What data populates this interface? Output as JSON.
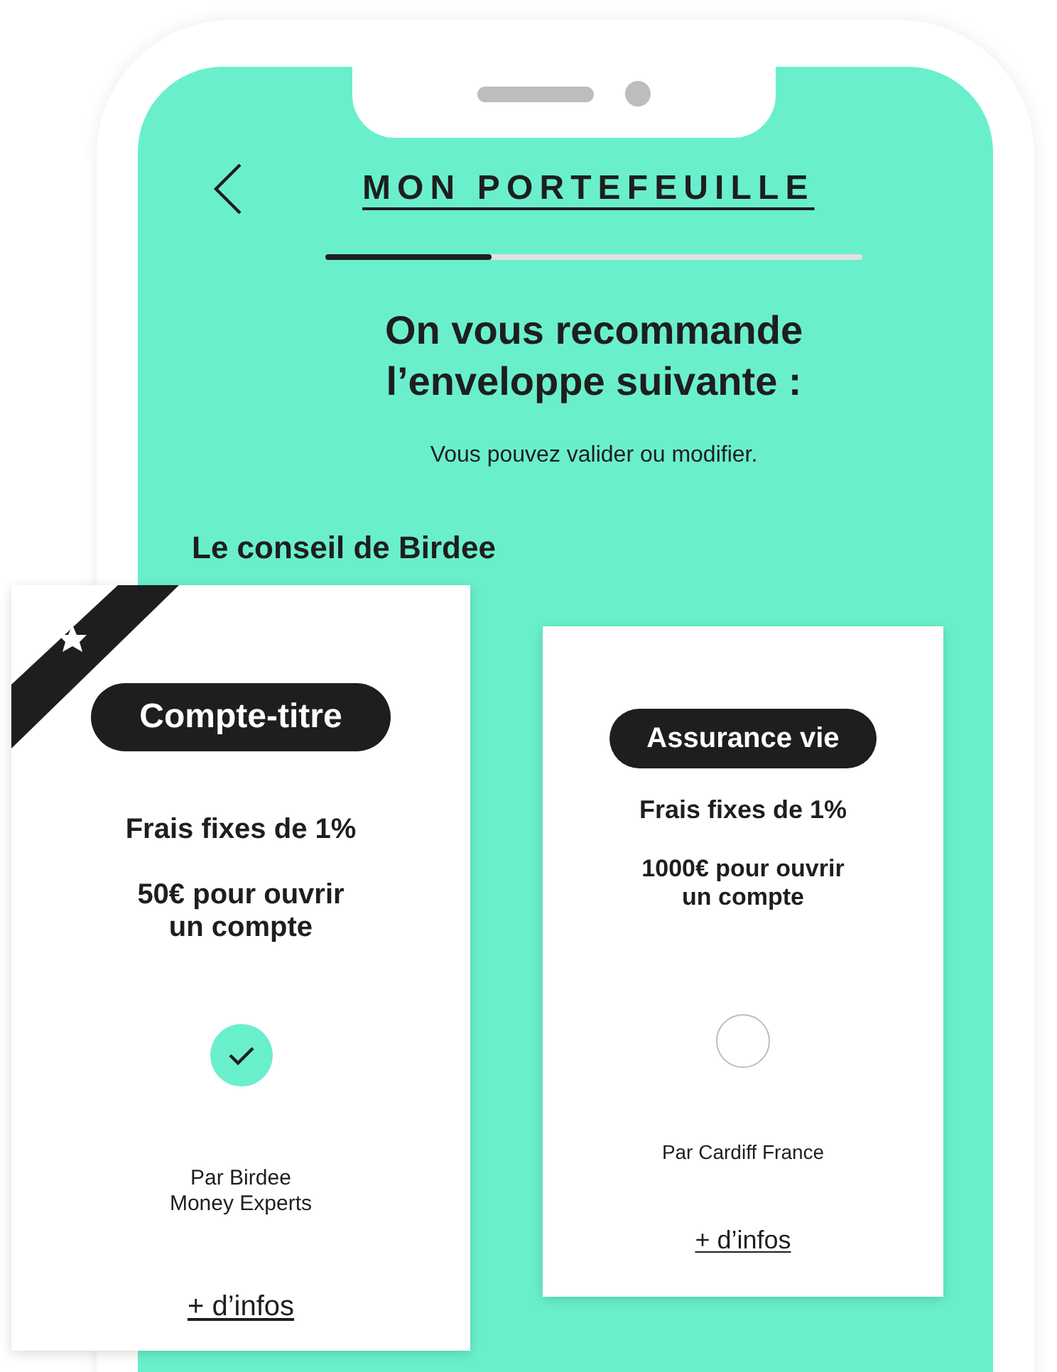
{
  "header": {
    "title": "MON PORTEFEUILLE",
    "progress": {
      "level": 0.31
    }
  },
  "heading": "On vous recommande\nl’enveloppe suivante :",
  "subtitle": "Vous pouvez valider ou modifier.",
  "section_title": "Le conseil de Birdee",
  "cards": [
    {
      "name": "Compte-titre",
      "recommended": true,
      "fees": "Frais fixes de 1%",
      "minimum": "50€ pour ouvrir\nun compte",
      "selected": true,
      "provider": "Par Birdee\nMoney Experts",
      "link": "+ d’infos"
    },
    {
      "name": "Assurance vie",
      "recommended": false,
      "fees": "Frais fixes de 1%",
      "minimum": "1000€ pour ouvrir\nun compte",
      "selected": false,
      "provider": "Par Cardiff France",
      "link": "+ d’infos"
    }
  ]
}
